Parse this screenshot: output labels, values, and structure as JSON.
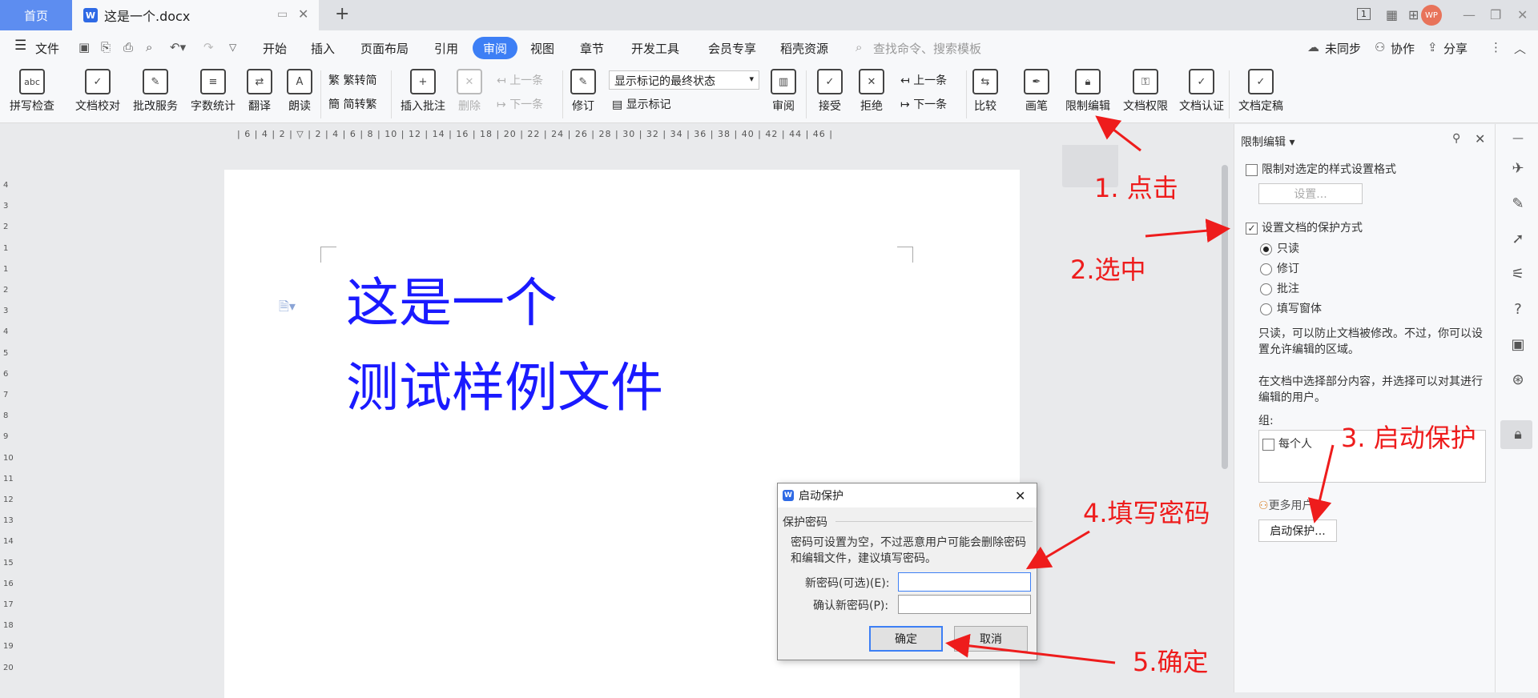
{
  "titlebar": {
    "home_tab": "首页",
    "doc_tab": "这是一个.docx",
    "word_icon": "W",
    "add_tab": "+",
    "page_badge": "1",
    "user_avatar": "WP",
    "window_controls": [
      "—",
      "❐",
      "✕"
    ]
  },
  "menu": {
    "file": "文件",
    "tabs": [
      "开始",
      "插入",
      "页面布局",
      "引用",
      "审阅",
      "视图",
      "章节",
      "开发工具",
      "会员专享",
      "稻壳资源"
    ],
    "active_tab": "审阅",
    "search_placeholder": "查找命令、搜索模板",
    "sync": "未同步",
    "collab": "协作",
    "share": "分享"
  },
  "ribbon": {
    "spell": "拼写检查",
    "proof": "文档校对",
    "correct": "批改服务",
    "wordcount": "字数统计",
    "translate": "翻译",
    "read": "朗读",
    "t2s": "繁转简",
    "s2t": "简转繁",
    "insert_comment": "插入批注",
    "delete": "删除",
    "prev": "上一条",
    "next": "下一条",
    "track": "修订",
    "markup_state": "显示标记的最终状态",
    "show_markup": "显示标记",
    "review": "审阅",
    "accept": "接受",
    "reject": "拒绝",
    "prev2": "上一条",
    "next2": "下一条",
    "compare": "比较",
    "pen": "画笔",
    "restrict": "限制编辑",
    "rights": "文档权限",
    "certify": "文档认证",
    "finalize": "文档定稿",
    "spell_icon": "abc"
  },
  "ruler": {
    "h_ticks": "| 6 |  4 |  2 |  ▽  | 2 |  4 |  6 |  8 | 10 | 12 | 14 | 16 | 18 | 20 | 22 | 24 | 26 | 28 | 30 | 32 | 34 | 36 | 38 | 40 | 42 | 44 | 46 |",
    "v_ticks": [
      "4",
      "3",
      "2",
      "1",
      "1",
      "2",
      "3",
      "4",
      "5",
      "6",
      "7",
      "8",
      "9",
      "10",
      "11",
      "12",
      "13",
      "14",
      "15",
      "16",
      "17",
      "18",
      "19",
      "20"
    ]
  },
  "document": {
    "line1": "这是一个",
    "line2": "测试样例文件"
  },
  "panel": {
    "title": "限制编辑",
    "limit_format": "限制对选定的样式设置格式",
    "settings_btn": "设置...",
    "protect_mode": "设置文档的保护方式",
    "options": [
      "只读",
      "修订",
      "批注",
      "填写窗体"
    ],
    "desc1": "只读，可以防止文档被修改。不过，你可以设置允许编辑的区域。",
    "desc2": "在文档中选择部分内容，并选择可以对其进行编辑的用户。",
    "group_label": "组:",
    "everyone": "每个人",
    "more_users": "更多用户...",
    "start_btn": "启动保护..."
  },
  "dialog": {
    "title": "启动保护",
    "section": "保护密码",
    "info": "密码可设置为空，不过恶意用户可能会删除密码和编辑文件，建议填写密码。",
    "new_pwd": "新密码(可选)(E):",
    "confirm_pwd": "确认新密码(P):",
    "ok": "确定",
    "cancel": "取消"
  },
  "annotations": [
    "1. 点击",
    "2.选中",
    "3. 启动保护",
    "4.填写密码",
    "5.确定"
  ],
  "colors": {
    "accent": "#3d7ff5",
    "annotation": "#ee1c1c",
    "doc_text": "#1a1aff"
  }
}
